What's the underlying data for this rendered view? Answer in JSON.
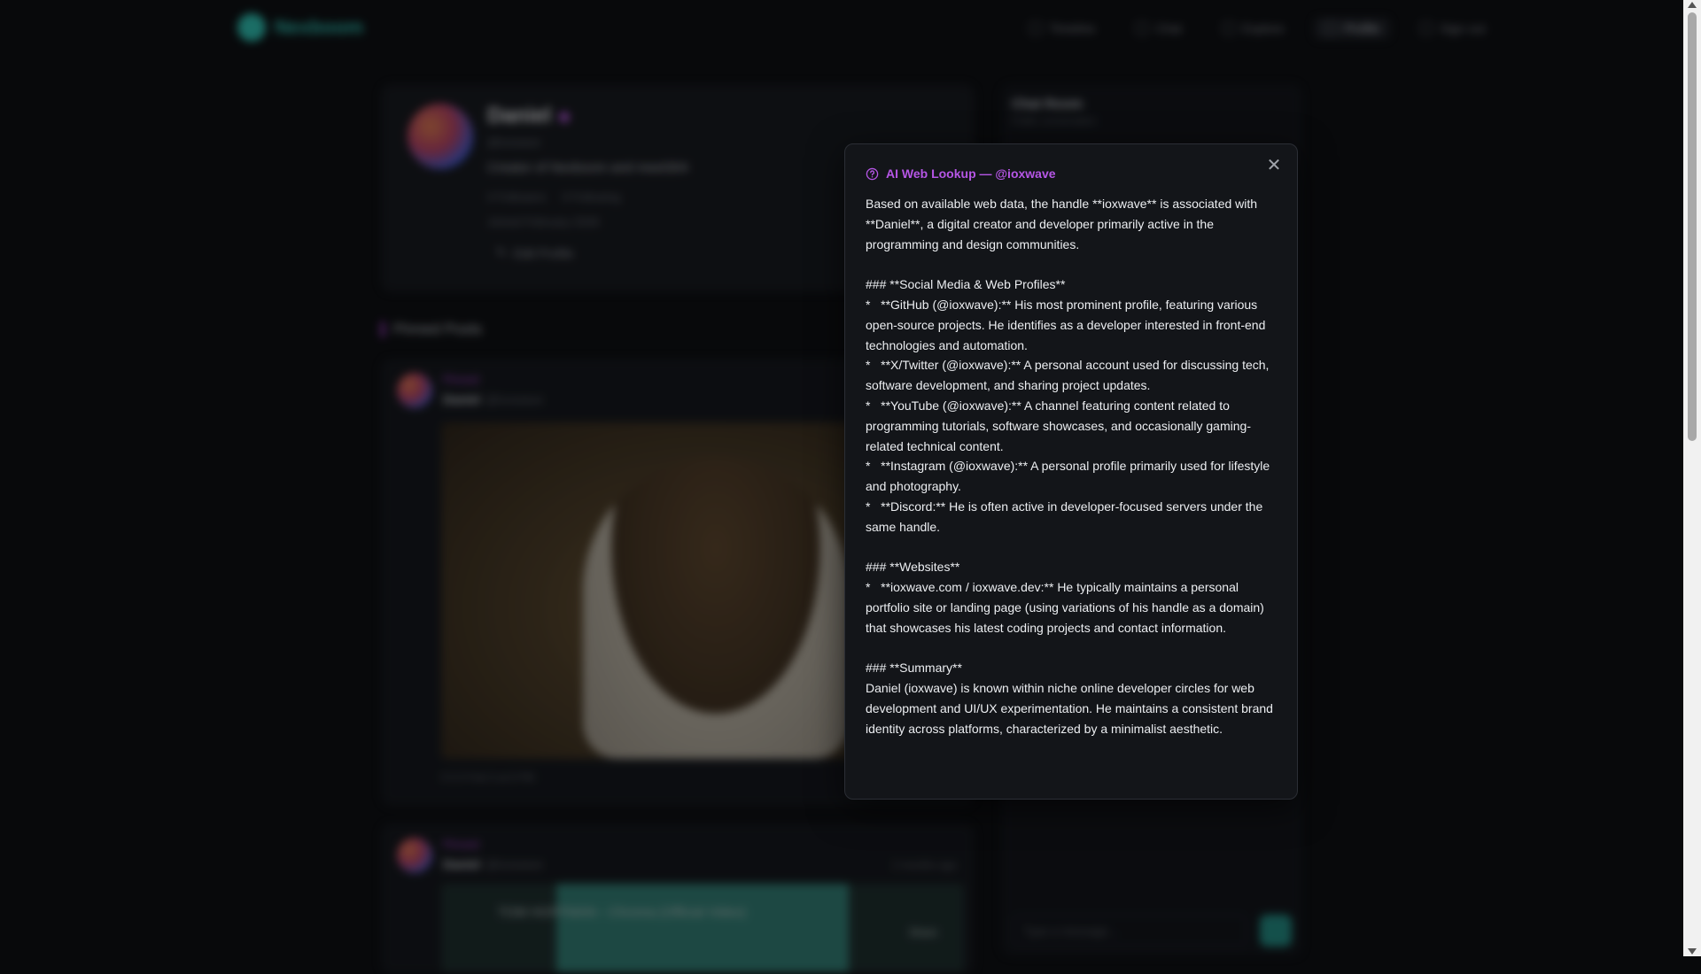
{
  "app": {
    "brand_name": "Nexboom"
  },
  "nav": {
    "items": [
      {
        "label": "Timeline",
        "icon": "home-icon",
        "active": false
      },
      {
        "label": "Chat",
        "icon": "chat-icon",
        "active": false
      },
      {
        "label": "Explore",
        "icon": "search-icon",
        "active": false
      },
      {
        "label": "Profile",
        "icon": "user-icon",
        "active": true
      },
      {
        "label": "Sign out",
        "icon": "logout-icon",
        "active": false
      }
    ]
  },
  "profile": {
    "name": "Daniel",
    "handle": "@ioxwave",
    "bio": "Creator of Nexboom and meet304",
    "followers": "0 Followers",
    "following": "0 Following",
    "joined": "Joined February 2026",
    "edit_label": "Edit Profile"
  },
  "pinned": {
    "heading": "Pinned Posts",
    "posts": [
      {
        "pinned_label": "Pinned",
        "author": "Daniel",
        "handle": "@ioxwave",
        "meta": "0   0   0   Feb 5 at 6 PM"
      },
      {
        "pinned_label": "Pinned",
        "author": "Daniel",
        "handle": "@ioxwave",
        "time": "2 months ago",
        "video_title": "TOM HOFFMAN - Chroma (Official Video)",
        "share_label": "Share"
      }
    ]
  },
  "chat": {
    "title": "Chat Room",
    "subtitle": "Public conversation",
    "input_placeholder": "Type a message..."
  },
  "modal": {
    "title": "AI Web Lookup — @ioxwave",
    "close_icon": "close-icon",
    "accent": "#b656e6",
    "paragraphs": [
      "Based on available web data, the handle **ioxwave** is associated with **Daniel**, a digital creator and developer primarily active in the programming and design communities.",
      "",
      "### **Social Media & Web Profiles**",
      "*   **GitHub (@ioxwave):** His most prominent profile, featuring various open-source projects. He identifies as a developer interested in front-end technologies and automation.",
      "*   **X/Twitter (@ioxwave):** A personal account used for discussing tech, software development, and sharing project updates.",
      "*   **YouTube (@ioxwave):** A channel featuring content related to programming tutorials, software showcases, and occasionally gaming-related technical content.",
      "*   **Instagram (@ioxwave):** A personal profile primarily used for lifestyle and photography.",
      "*   **Discord:** He is often active in developer-focused servers under the same handle.",
      "",
      "### **Websites**",
      "*   **ioxwave.com / ioxwave.dev:** He typically maintains a personal portfolio site or landing page (using variations of his handle as a domain) that showcases his latest coding projects and contact information.",
      "",
      "### **Summary**",
      "Daniel (ioxwave) is known within niche online developer circles for web development and UI/UX experimentation. He maintains a consistent brand identity across platforms, characterized by a minimalist aesthetic."
    ]
  }
}
